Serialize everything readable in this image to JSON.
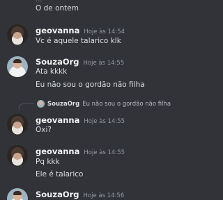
{
  "top": {
    "truncated_name": "...",
    "trailing_message": "O de ontem"
  },
  "messages": [
    {
      "username": "geovanna",
      "timestamp": "Hoje às 14:54",
      "lines": [
        "Vc é aquele talarico klk"
      ]
    },
    {
      "username": "SouzaOrg",
      "timestamp": "Hoje às 14:55",
      "lines": [
        "Ata kkkk",
        "Eu não sou o gordão não filha"
      ]
    },
    {
      "reply": {
        "username": "SouzaOrg",
        "text": "Eu não sou o gordão não filha"
      },
      "username": "geovanna",
      "timestamp": "Hoje às 14:55",
      "lines": [
        "Oxi?"
      ]
    },
    {
      "username": "geovanna",
      "timestamp": "Hoje às 14:55",
      "lines": [
        "Pq kkk",
        "Ele é talarico"
      ]
    },
    {
      "username": "SouzaOrg",
      "timestamp": "Hoje às 14:56",
      "lines": []
    }
  ],
  "colors": {
    "background": "#313338",
    "username": "#f2f3f5",
    "timestamp": "#949ba4",
    "message_text": "#dbdee1"
  }
}
